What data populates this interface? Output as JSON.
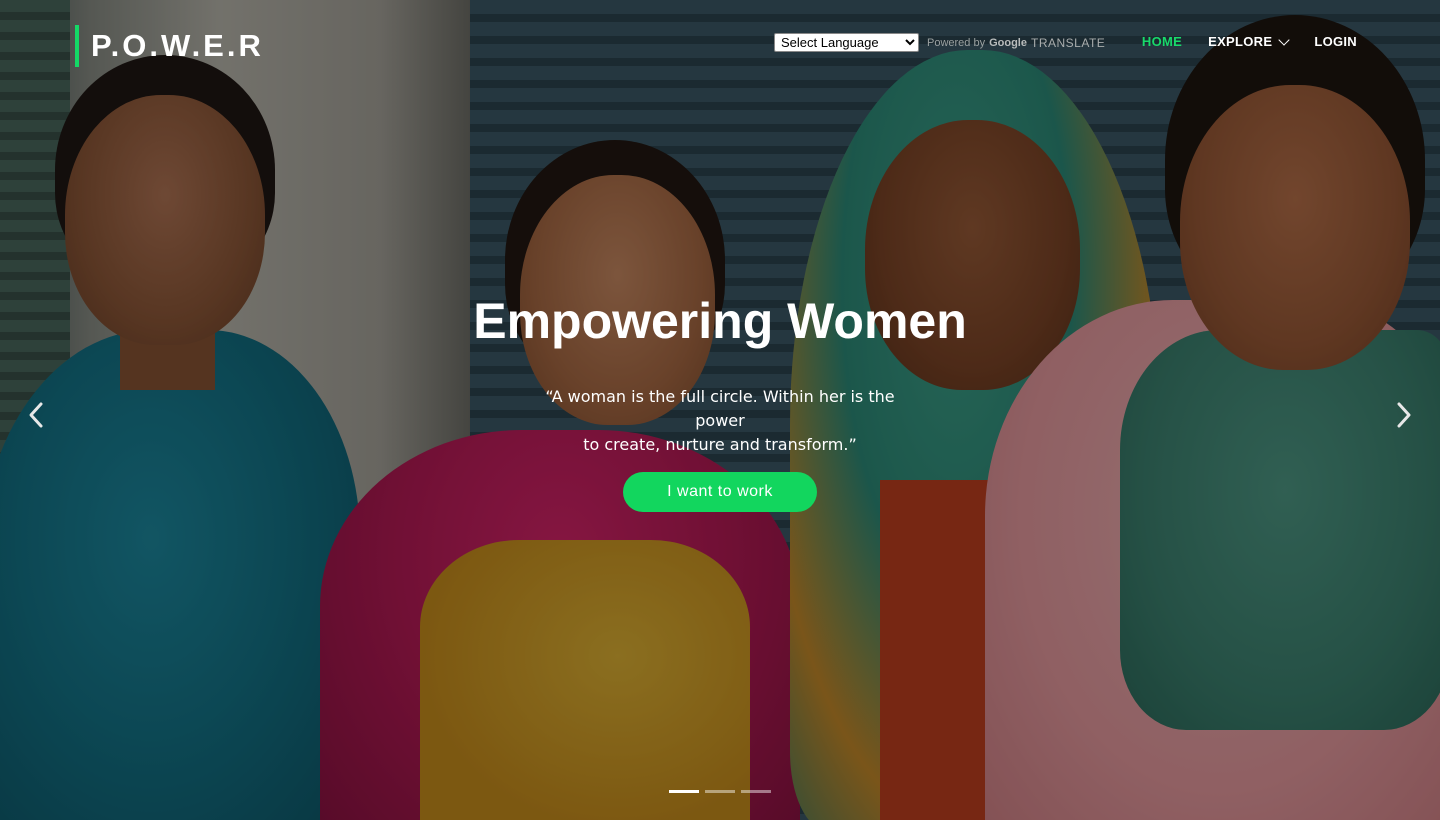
{
  "brand": {
    "name": "P.O.W.E.R",
    "accent_color": "#14d966"
  },
  "translate": {
    "select_value": "Select Language",
    "powered_by": "Powered by",
    "google": "Google",
    "translate_label": "TRANSLATE"
  },
  "nav": {
    "home": "HOME",
    "explore": "EXPLORE",
    "login": "LOGIN",
    "active_color": "#18d96a"
  },
  "hero": {
    "title": "Empowering Women",
    "quote_line1": "“A woman is the full circle. Within her is the power",
    "quote_line2": "to create, nurture and transform.”",
    "cta_label": "I want to work",
    "cta_color": "#12d65e"
  },
  "carousel": {
    "prev_icon": "chevron-left-icon",
    "next_icon": "chevron-right-icon",
    "slide_count": 3,
    "active_slide": 1
  }
}
